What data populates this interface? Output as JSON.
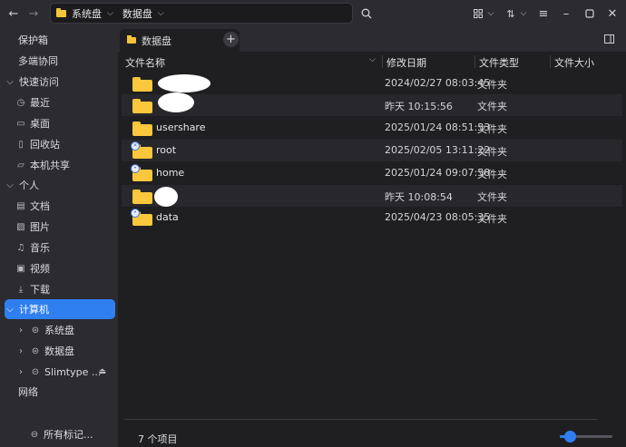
{
  "titlebar": {
    "breadcrumbs": [
      "系统盘",
      "数据盘"
    ]
  },
  "sidebar": {
    "items": [
      {
        "label": "保护箱",
        "icon": ""
      },
      {
        "label": "多端协同",
        "icon": ""
      },
      {
        "label": "快速访问",
        "icon": "chevron-down-icon"
      },
      {
        "label": "最近",
        "icon": "clock-icon"
      },
      {
        "label": "桌面",
        "icon": "desktop-icon"
      },
      {
        "label": "回收站",
        "icon": "trash-icon"
      },
      {
        "label": "本机共享",
        "icon": "folder-icon"
      },
      {
        "label": "个人",
        "icon": "chevron-down-icon"
      },
      {
        "label": "文档",
        "icon": "document-icon"
      },
      {
        "label": "图片",
        "icon": "image-icon"
      },
      {
        "label": "音乐",
        "icon": "music-icon"
      },
      {
        "label": "视频",
        "icon": "video-icon"
      },
      {
        "label": "下载",
        "icon": "download-icon"
      },
      {
        "label": "计算机",
        "icon": "chevron-down-icon"
      },
      {
        "label": "系统盘",
        "icon": "disk-icon"
      },
      {
        "label": "数据盘",
        "icon": "disk-icon"
      },
      {
        "label": "Slimtype ...",
        "icon": "disk-icon"
      },
      {
        "label": "网络",
        "icon": ""
      },
      {
        "label": "所有标记...",
        "icon": "tag-icon"
      }
    ]
  },
  "tab": {
    "label": "数据盘"
  },
  "columns": {
    "name": "文件名称",
    "modified": "修改日期",
    "type": "文件类型",
    "size": "文件大小"
  },
  "files": [
    {
      "name": "",
      "modified": "2024/02/27 08:03:45",
      "type": "文件夹"
    },
    {
      "name": "",
      "modified": "昨天 10:15:56",
      "type": "文件夹"
    },
    {
      "name": "usershare",
      "modified": "2025/01/24 08:51:53",
      "type": "文件夹"
    },
    {
      "name": "root",
      "modified": "2025/02/05 13:11:22",
      "type": "文件夹"
    },
    {
      "name": "home",
      "modified": "2025/01/24 09:07:58",
      "type": "文件夹"
    },
    {
      "name": "",
      "modified": "昨天 10:08:54",
      "type": "文件夹"
    },
    {
      "name": "data",
      "modified": "2025/04/23 08:05:35",
      "type": "文件夹"
    }
  ],
  "status": {
    "count": "7 个项目"
  },
  "colors": {
    "accent": "#2f7ff0",
    "folder": "#fbc73c"
  }
}
